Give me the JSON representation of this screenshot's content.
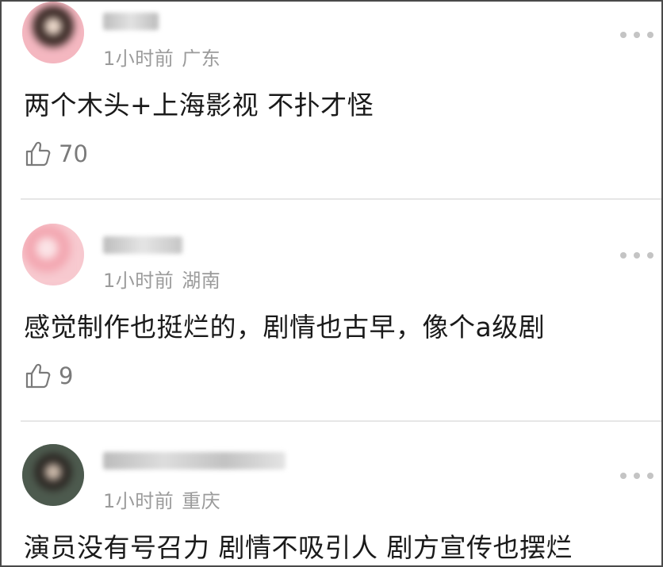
{
  "comments": [
    {
      "time": "1小时前",
      "location": "广东",
      "text": "两个木头+上海影视 不扑才怪",
      "likes": "70",
      "avatar_colors": [
        "#f4b7c0",
        "#3a2a26",
        "#e9d6c8"
      ]
    },
    {
      "time": "1小时前",
      "location": "湖南",
      "text": "感觉制作也挺烂的，剧情也古早，像个a级剧",
      "likes": "9",
      "avatar_colors": [
        "#f7c9cf",
        "#f3a8b2",
        "#fbe3e6"
      ]
    },
    {
      "time": "1小时前",
      "location": "重庆",
      "text": "演员没有号召力 剧情不吸引人 剧方宣传也摆烂",
      "likes": "",
      "avatar_colors": [
        "#4d5a4e",
        "#2a2622",
        "#c9b7a8"
      ]
    }
  ],
  "icons": {
    "like": "thumbs-up-icon",
    "more": "more-dots-icon"
  }
}
